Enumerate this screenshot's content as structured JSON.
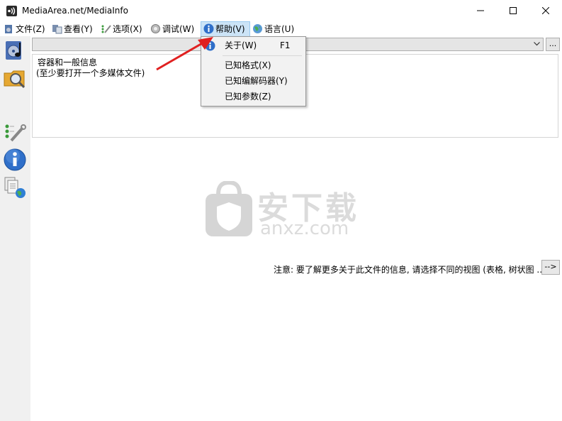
{
  "window": {
    "title": "MediaArea.net/MediaInfo"
  },
  "menu": {
    "file": "文件(Z)",
    "view": "查看(Y)",
    "options": "选项(X)",
    "debug": "调试(W)",
    "help": "帮助(V)",
    "language": "语言(U)"
  },
  "help_menu": {
    "items": [
      {
        "label": "关于(W)",
        "shortcut": "F1"
      },
      {
        "label": "已知格式(X)"
      },
      {
        "label": "已知编解码器(Y)"
      },
      {
        "label": "已知参数(Z)"
      }
    ]
  },
  "main": {
    "browse_label": "...",
    "info_title": "容器和一般信息",
    "info_hint": "(至少要打开一个多媒体文件)",
    "note": "注意: 要了解更多关于此文件的信息, 请选择不同的视图 (表格, 树状图 ...)",
    "arrow_button": "-->"
  },
  "watermark": {
    "cn": "安下载",
    "en": "anxz.com"
  },
  "icons": {
    "app": "mediainfo-app-icon",
    "minimize": "minimize-icon",
    "maximize": "maximize-icon",
    "close": "close-icon"
  },
  "colors": {
    "menu_active_bg": "#cce4f7",
    "toolbar_bg": "#f0f0f0",
    "annotation_arrow": "#e02020"
  }
}
